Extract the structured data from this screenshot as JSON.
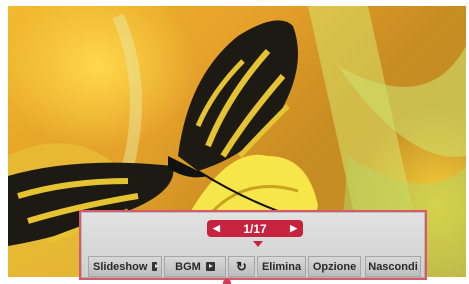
{
  "viewer": {
    "pager": {
      "prev_icon": "◀",
      "next_icon": "▶",
      "counter": "1/17"
    },
    "buttons": {
      "slideshow_label": "Slideshow",
      "bgm_label": "BGM",
      "rotate_icon": "↻",
      "delete_label": "Elimina",
      "option_label": "Opzione",
      "hide_label": "Nascondi"
    }
  },
  "colors": {
    "accent": "#c6233f",
    "panel": "#d6d6d6",
    "panel_border": "#d65a6a"
  }
}
